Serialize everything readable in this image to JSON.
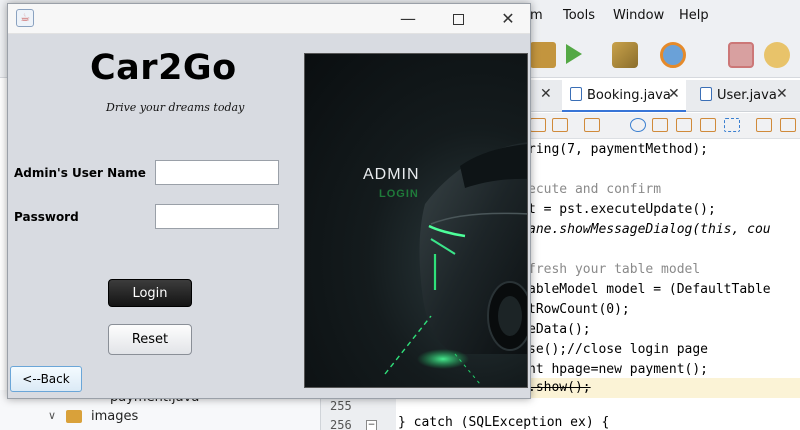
{
  "ide": {
    "menu": [
      "m",
      "Tools",
      "Window",
      "Help"
    ],
    "tabs": [
      {
        "label": "Booking.java"
      },
      {
        "label": "User.java"
      }
    ],
    "tab_close": "✕",
    "code_lines": [
      {
        "t": "ring(7, paymentMethod);"
      },
      {
        "t": ""
      },
      {
        "t": "ecute and confirm"
      },
      {
        "t": "t = pst.executeUpdate();"
      },
      {
        "t": "ane.showMessageDialog(this, cou"
      },
      {
        "t": ""
      },
      {
        "t": "fresh your table model"
      },
      {
        "t": "ableModel model = (DefaultTable"
      },
      {
        "t": "tRowCount(0);"
      },
      {
        "t": "eData();"
      },
      {
        "t": "se();//close login page"
      },
      {
        "t": "nt hpage=new payment();"
      },
      {
        "t": ".show();"
      }
    ],
    "tree": {
      "payment_file": "payment.java",
      "images_folder": "images"
    },
    "gutter": [
      "255",
      "256"
    ],
    "code_bottom": "} catch (SQLException ex) {"
  },
  "dialog": {
    "logo": "Car2Go",
    "tagline": "Drive your dreams today",
    "username_label": "Admin's User Name",
    "password_label": "Password",
    "username_value": "",
    "password_value": "",
    "login_label": "Login",
    "reset_label": "Reset",
    "back_label": "<--Back",
    "poster_admin": "ADMIN",
    "poster_login": "LOGIN",
    "window_min": "—",
    "window_close": "✕"
  },
  "colors": {
    "accent_green": "#1fd36a",
    "dialog_bg": "#d8dbe1",
    "keyword": "#1c39c8"
  }
}
